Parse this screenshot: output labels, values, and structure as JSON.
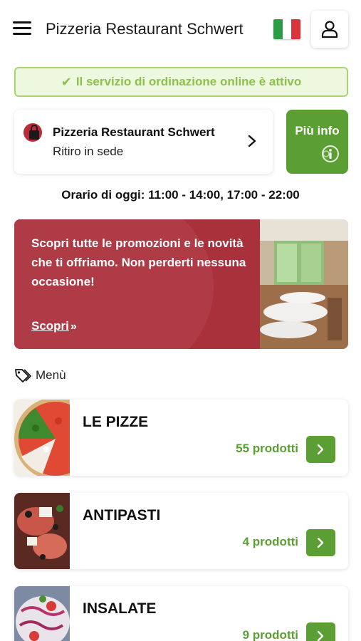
{
  "header": {
    "title": "Pizzeria Restaurant Schwert",
    "menu_icon": "hamburger-icon",
    "language_flag": "italian-flag",
    "flag_colors": [
      "#2d9a45",
      "#ffffff",
      "#d9343b"
    ],
    "user_icon": "user-icon"
  },
  "status": {
    "text": "Il servizio di ordinazione online è attivo",
    "icon": "check-icon",
    "color": "#8cc14c"
  },
  "restaurant": {
    "name": "Pizzeria Restaurant Schwert",
    "mode": "Ritiro in sede",
    "icon": "shopping-bag-icon"
  },
  "info_button": {
    "label": "Più info",
    "icon": "info-icon"
  },
  "hours": {
    "text": "Orario di oggi: 11:00 - 14:00, 17:00 - 22:00"
  },
  "promo": {
    "text": "Scopri tutte le promozioni e le novità che ti offriamo. Non perderti nessuna occasione!",
    "link_label": "Scopri",
    "link_icon": "double-chevron-right-icon",
    "color": "#a8313c"
  },
  "menu": {
    "title": "Menù",
    "icon": "tag-icon",
    "categories": [
      {
        "name": "LE PIZZE",
        "count": "55 prodotti"
      },
      {
        "name": "ANTIPASTI",
        "count": "4 prodotti"
      },
      {
        "name": "INSALATE",
        "count": "9 prodotti"
      }
    ]
  },
  "colors": {
    "accent_green": "#5a9e34",
    "promo_red": "#a8313c"
  }
}
